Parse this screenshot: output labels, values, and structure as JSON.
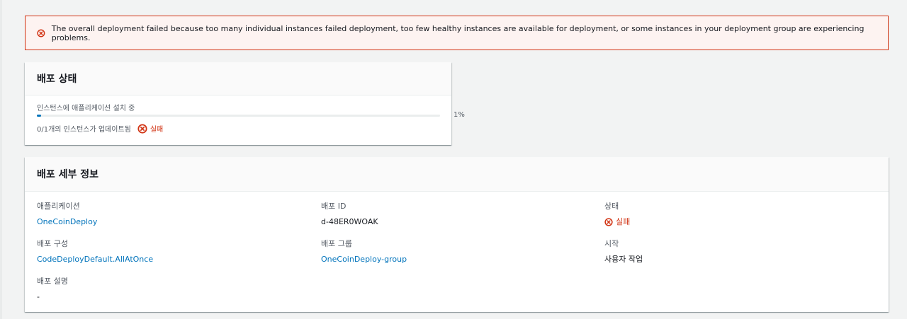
{
  "alert": {
    "message": "The overall deployment failed because too many individual instances failed deployment, too few healthy instances are available for deployment, or some instances in your deployment group are experiencing problems."
  },
  "status": {
    "title": "배포 상태",
    "progress_label": "인스턴스에 애플리케이션 설치 중",
    "progress_percent": 1,
    "progress_text": "1%",
    "instances_updated": "0/1개의 인스턴스가 업데이트됨",
    "result": "실패"
  },
  "details": {
    "title": "배포 세부 정보",
    "application_label": "애플리케이션",
    "application_value": "OneCoinDeploy",
    "deployment_id_label": "배포 ID",
    "deployment_id_value": "d-48ER0WOAK",
    "status_label": "상태",
    "status_value": "실패",
    "config_label": "배포 구성",
    "config_value": "CodeDeployDefault.AllAtOnce",
    "group_label": "배포 그룹",
    "group_value": "OneCoinDeploy-group",
    "start_label": "시작",
    "start_value": "사용자 작업",
    "description_label": "배포 설명",
    "description_value": "-"
  },
  "colors": {
    "error": "#d13212",
    "link": "#0073bb",
    "progress": "#0073bb"
  }
}
